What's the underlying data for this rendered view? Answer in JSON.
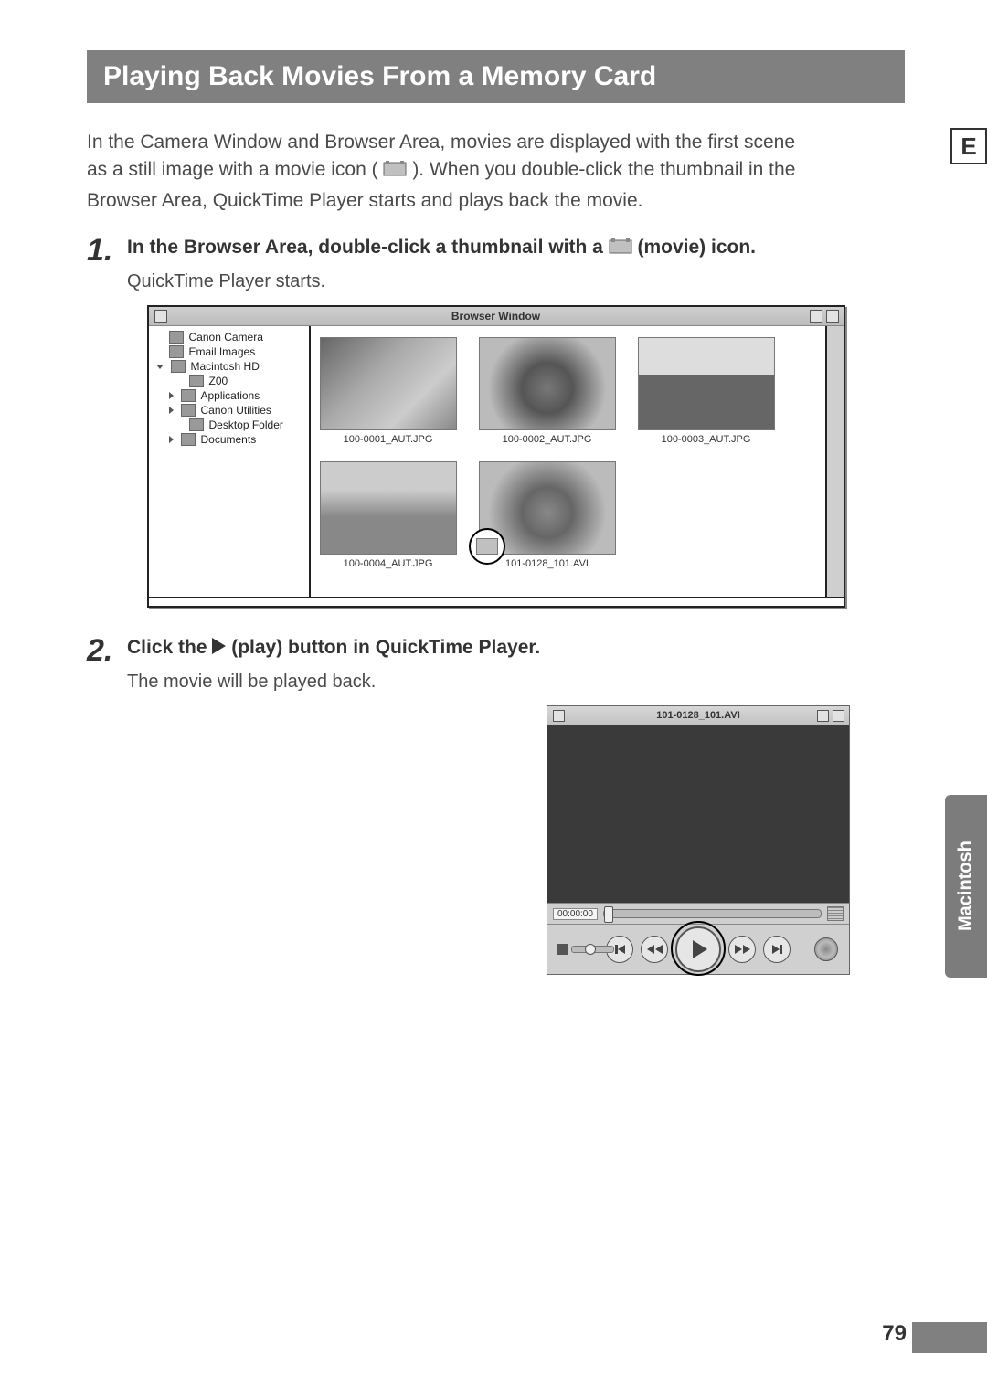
{
  "heading": "Playing Back Movies From a Memory Card",
  "intro_before": "In the Camera Window and Browser Area, movies are displayed with the first scene as a still image with a movie icon (",
  "intro_after": "). When you double-click the thumbnail in the Browser Area, QuickTime Player starts and plays back the movie.",
  "step1": {
    "num": "1.",
    "text_before": "In the Browser Area, double-click a thumbnail with a ",
    "text_after": " (movie) icon.",
    "sub": "QuickTime Player starts."
  },
  "browser": {
    "title": "Browser Window",
    "sidebar": [
      {
        "label": "Canon Camera",
        "indent": 1,
        "arrow": "none"
      },
      {
        "label": "Email Images",
        "indent": 1,
        "arrow": "none"
      },
      {
        "label": "Macintosh HD",
        "indent": 0,
        "arrow": "open"
      },
      {
        "label": "Z00",
        "indent": 2,
        "arrow": "none"
      },
      {
        "label": "Applications",
        "indent": 1,
        "arrow": "closed"
      },
      {
        "label": "Canon Utilities",
        "indent": 2,
        "arrow": "closed"
      },
      {
        "label": "Desktop Folder",
        "indent": 2,
        "arrow": "none"
      },
      {
        "label": "Documents",
        "indent": 1,
        "arrow": "closed"
      }
    ],
    "thumbs_row1": [
      {
        "label": "100-0001_AUT.JPG",
        "cls": "parrot"
      },
      {
        "label": "100-0002_AUT.JPG",
        "cls": "turtle"
      },
      {
        "label": "100-0003_AUT.JPG",
        "cls": "cow"
      }
    ],
    "thumbs_row2": [
      {
        "label": "100-0004_AUT.JPG",
        "cls": "giraffe",
        "movie": false
      },
      {
        "label": "101-0128_101.AVI",
        "cls": "seal",
        "movie": true
      }
    ]
  },
  "step2": {
    "num": "2.",
    "text_before": "Click the ",
    "text_after": " (play) button in QuickTime Player.",
    "sub": "The movie will be played back."
  },
  "qt": {
    "title": "101-0128_101.AVI",
    "time": "00:00:00"
  },
  "side_letter": "E",
  "side_tab": "Macintosh",
  "page_number": "79"
}
